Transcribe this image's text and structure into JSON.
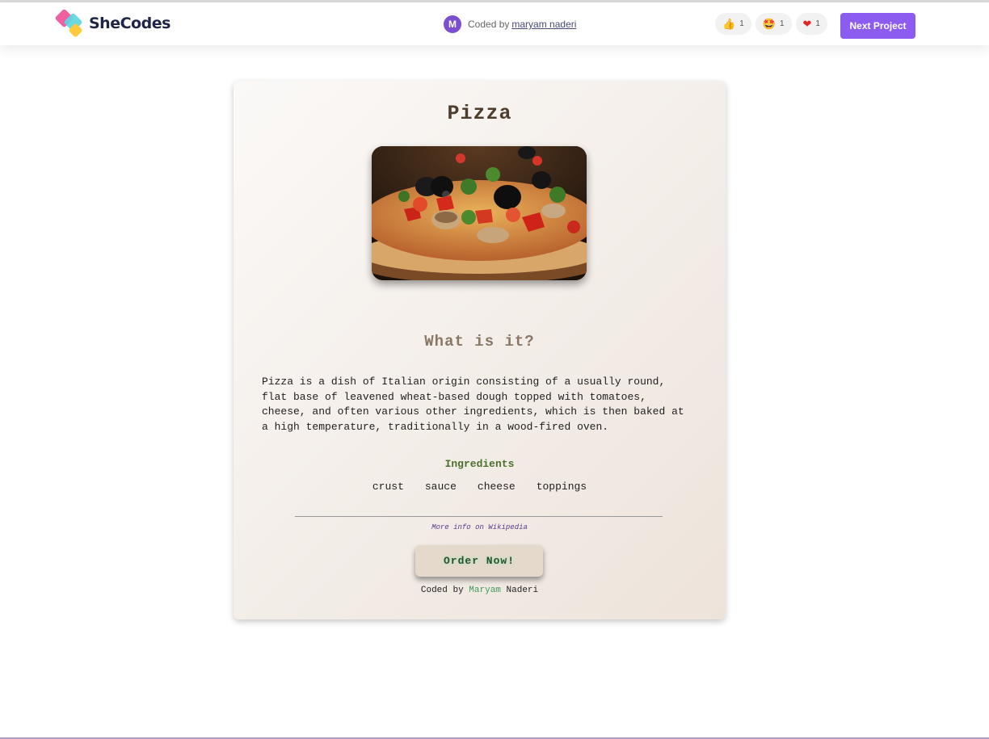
{
  "header": {
    "brand": "SheCodes",
    "coded_by_prefix": "Coded by",
    "author_link": "maryam naderi",
    "avatar_initial": "M",
    "reactions": [
      {
        "icon": "thumbs-up",
        "emoji": "👍",
        "count": "1"
      },
      {
        "icon": "star-struck",
        "emoji": "🤩",
        "count": "1"
      },
      {
        "icon": "heart",
        "emoji": "❤",
        "count": "1"
      }
    ],
    "next_button": "Next Project"
  },
  "card": {
    "title": "Pizza",
    "subtitle": "What is it?",
    "description": "Pizza is a dish of Italian origin consisting of a usually round,\nflat base of leavened wheat-based dough topped with tomatoes,\ncheese, and often various other ingredients, which is then baked at\na high temperature, traditionally in a wood-fired oven.",
    "ingredients_title": "Ingredients",
    "ingredients": [
      "crust",
      "sauce",
      "cheese",
      "toppings"
    ],
    "more_info": "More info on Wikipedia",
    "order_button": "Order Now!",
    "credit_prefix": "Coded by",
    "credit_first": "Maryam",
    "credit_last": "Naderi"
  },
  "colors": {
    "accent": "#8c5cf0",
    "title": "#4d3d2c",
    "ingredients_title": "#4b6f2e"
  }
}
